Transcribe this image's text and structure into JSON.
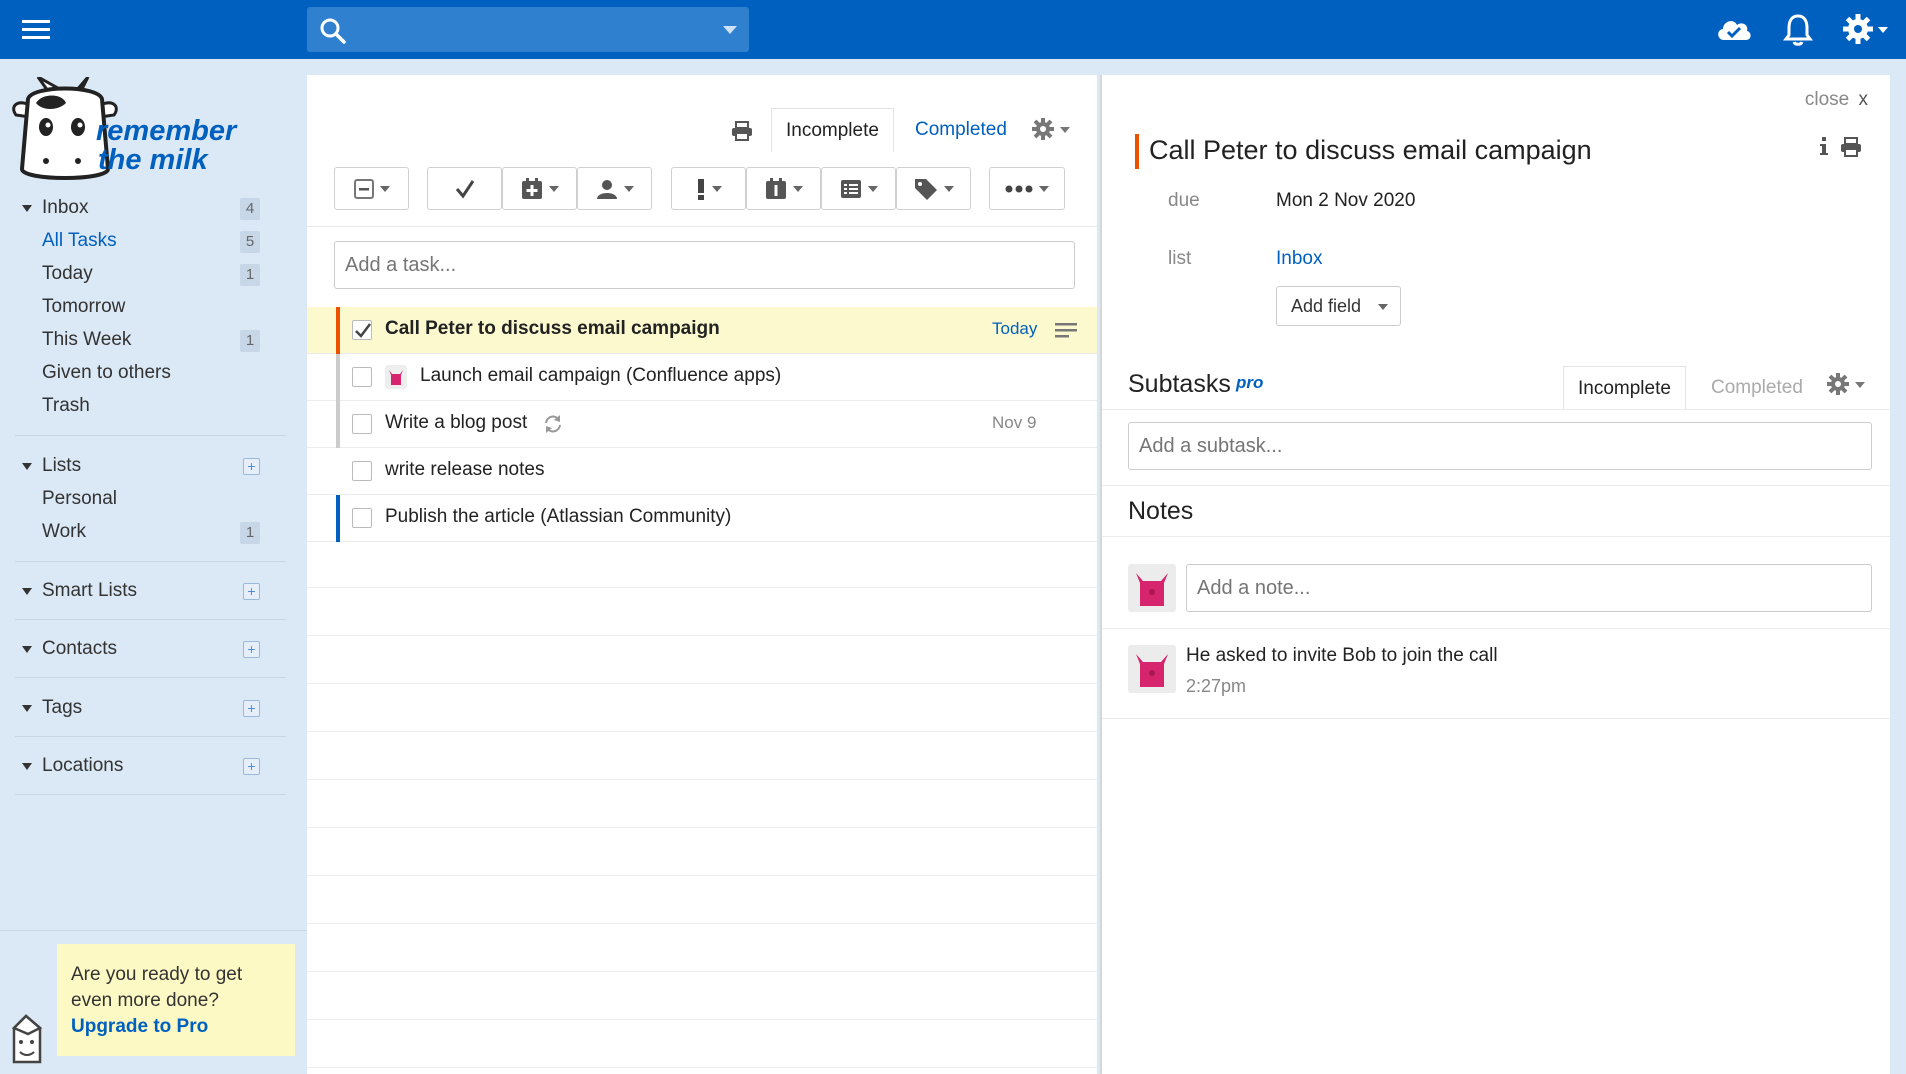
{
  "app": {
    "name_line1": "remember",
    "name_line2": "the milk",
    "brand_color": "#0060bf"
  },
  "topbar": {
    "menu_icon": "hamburger-icon",
    "search_icon": "search-icon",
    "search_placeholder": "",
    "right_icons": [
      "cloud-sync-icon",
      "bell-icon",
      "gear-icon"
    ]
  },
  "sidebar": {
    "inbox": {
      "label": "Inbox",
      "count": "4",
      "items": [
        {
          "label": "All Tasks",
          "count": "5",
          "active": true
        },
        {
          "label": "Today",
          "count": "1"
        },
        {
          "label": "Tomorrow",
          "count": ""
        },
        {
          "label": "This Week",
          "count": "1"
        },
        {
          "label": "Given to others",
          "count": ""
        },
        {
          "label": "Trash",
          "count": ""
        }
      ]
    },
    "lists": {
      "label": "Lists",
      "items": [
        {
          "label": "Personal",
          "count": ""
        },
        {
          "label": "Work",
          "count": "1"
        }
      ]
    },
    "smart_lists": {
      "label": "Smart Lists"
    },
    "contacts": {
      "label": "Contacts"
    },
    "tags": {
      "label": "Tags"
    },
    "locations": {
      "label": "Locations"
    },
    "plus_symbol": "+",
    "upgrade": {
      "line1": "Are you ready to get",
      "line2": "even more done?",
      "link": "Upgrade to Pro"
    }
  },
  "tasklist": {
    "tabs": {
      "incomplete": "Incomplete",
      "completed": "Completed"
    },
    "add_placeholder": "Add a task...",
    "tasks": [
      {
        "name": "Call Peter to discuss email campaign",
        "due": "Today",
        "checked": true,
        "selected": true,
        "priority_color": "#ea5200"
      },
      {
        "name": "Launch email campaign (Confluence apps)",
        "due": "",
        "checked": false,
        "selected": false,
        "priority_color": "#cccccc",
        "has_avatar": true
      },
      {
        "name": "Write a blog post",
        "due": "Nov 9",
        "checked": false,
        "selected": false,
        "priority_color": "#cccccc",
        "repeat": true
      },
      {
        "name": "write release notes",
        "due": "",
        "checked": false,
        "selected": false,
        "priority_color": "#cccccc"
      },
      {
        "name": "Publish the article (Atlassian Community)",
        "due": "",
        "checked": false,
        "selected": false,
        "priority_color": "#0060bf"
      }
    ]
  },
  "detail": {
    "close_label": "close",
    "close_x": "x",
    "title": "Call Peter to discuss email campaign",
    "due_label": "due",
    "due_value": "Mon 2 Nov 2020",
    "list_label": "list",
    "list_value": "Inbox",
    "add_field": "Add field",
    "subtasks_heading": "Subtasks",
    "pro_tag": "pro",
    "subtask_tabs": {
      "incomplete": "Incomplete",
      "completed": "Completed"
    },
    "subtask_placeholder": "Add a subtask...",
    "notes_heading": "Notes",
    "note_placeholder": "Add a note...",
    "notes": [
      {
        "text": "He asked to invite Bob to join the call",
        "time": "2:27pm"
      }
    ]
  }
}
